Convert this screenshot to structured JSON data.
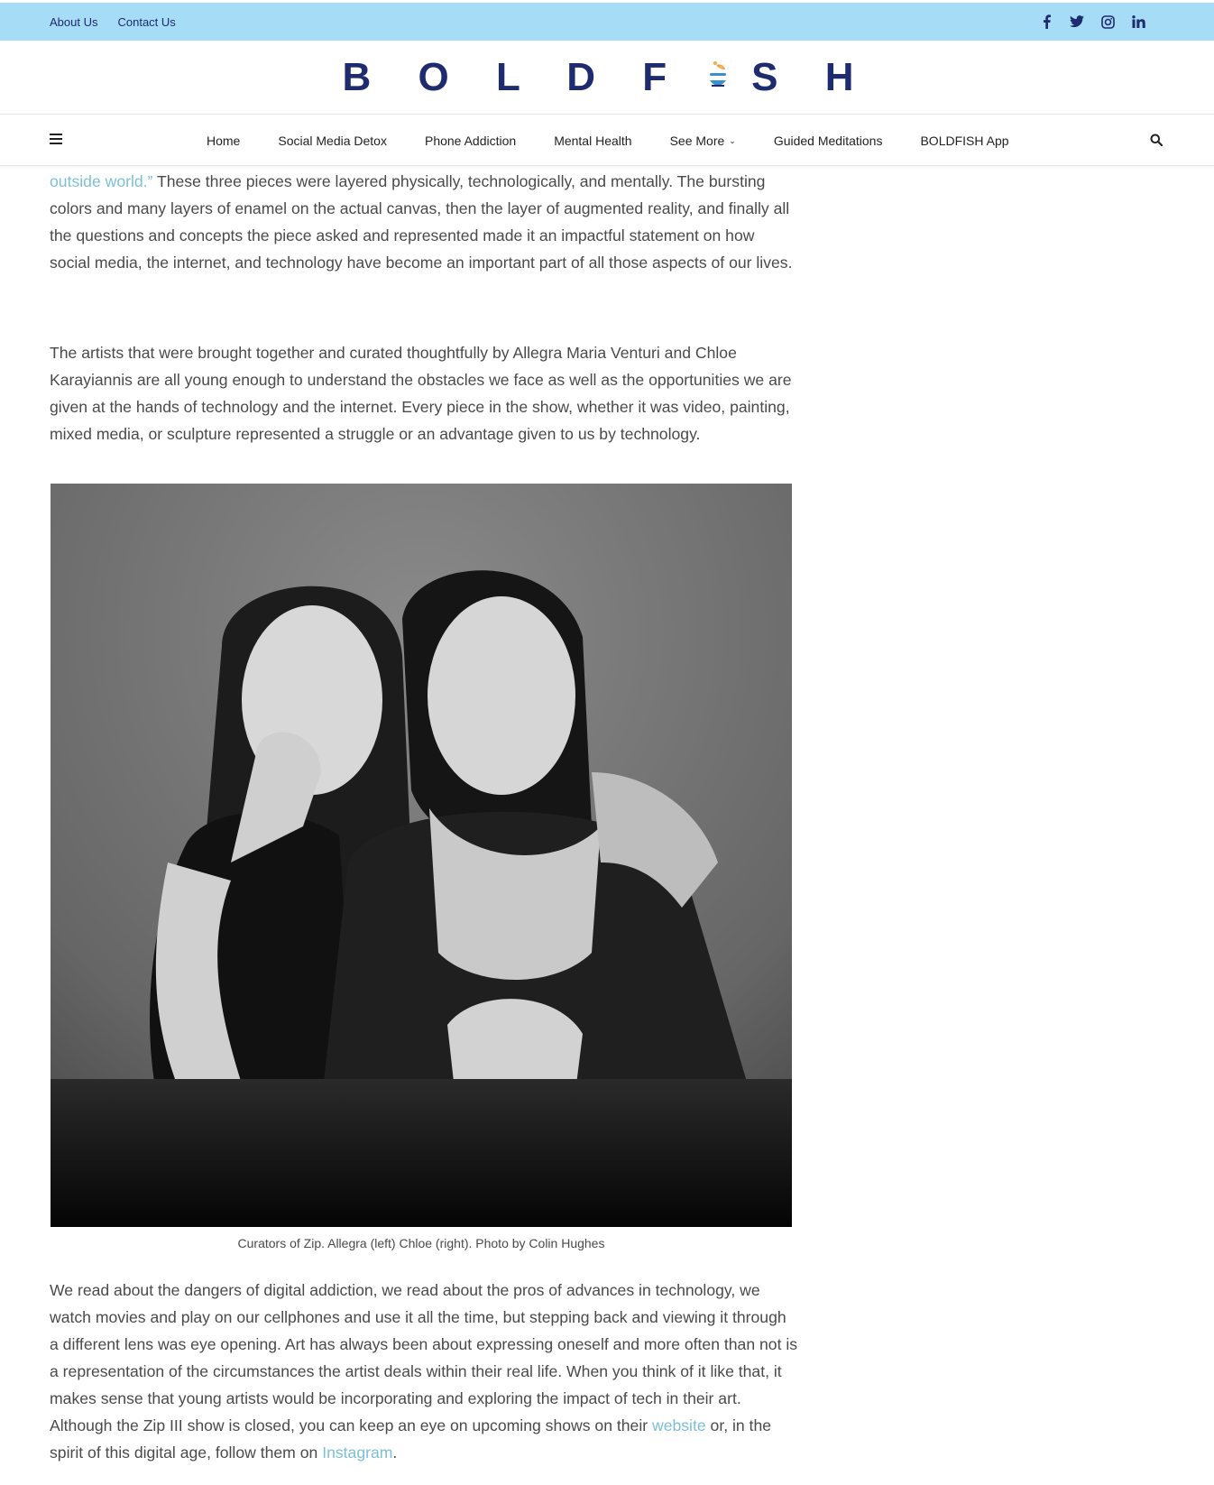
{
  "topbar": {
    "links": [
      "About Us",
      "Contact Us"
    ],
    "social_icons": [
      "facebook-icon",
      "twitter-icon",
      "instagram-icon",
      "linkedin-icon"
    ],
    "bg_color": "#a6dcf5"
  },
  "logo": {
    "text_before": "B O L D F",
    "text_after": "S H",
    "brand_color": "#1e2b6e"
  },
  "nav": {
    "items": [
      "Home",
      "Social Media Detox",
      "Phone Addiction",
      "Mental Health",
      "See More",
      "Guided Meditations",
      "BOLDFISH App"
    ]
  },
  "article": {
    "p1_link": "outside world.”",
    "p1_rest": " These three pieces were layered physically, technologically, and mentally. The bursting colors and many layers of enamel on the actual canvas, then the layer of augmented reality, and finally all the questions and concepts the piece asked and represented made it an impactful statement on how social media, the internet, and technology have become an important part of all those aspects of our lives.",
    "p2": "The artists that were brought together and curated thoughtfully by Allegra Maria Venturi and Chloe Karayiannis are all young enough to understand the obstacles we face as well as the opportunities we are given at the hands of technology and the internet. Every piece in the show, whether it was video, painting, mixed media, or sculpture represented a struggle or an advantage given to us by technology.",
    "caption": "Curators of Zip. Allegra (left) Chloe (right). Photo by Colin Hughes",
    "p3_a": "We read about the dangers of digital addiction, we read about the pros of advances in technology, we watch movies and play on our cellphones and use it all the time, but stepping back and viewing it through a different lens was eye opening. Art has always been about expressing oneself and more often than not is a representation of the circumstances the artist deals within their real life. When you think of it like that, it makes sense that young artists would be incorporating and exploring the impact of tech in their art. Although the Zip III show is closed, you can keep an eye on upcoming shows on their ",
    "p3_link1": "website",
    "p3_b": " or, in the spirit of this digital age, follow them on ",
    "p3_link2": "Instagram",
    "p3_c": ".",
    "link_color": "#7cbfd6"
  }
}
